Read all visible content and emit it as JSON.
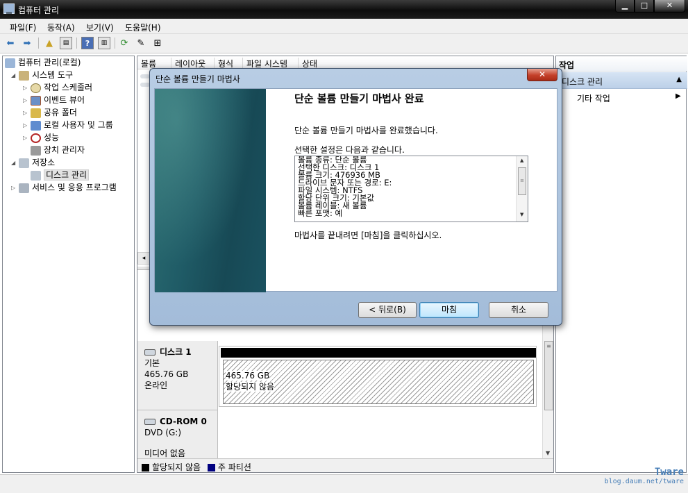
{
  "window": {
    "title": "컴퓨터 관리"
  },
  "menu": [
    "파일(F)",
    "동작(A)",
    "보기(V)",
    "도움말(H)"
  ],
  "tree": {
    "root": "컴퓨터 관리(로컬)",
    "system_tools": "시스템 도구",
    "task_scheduler": "작업 스케줄러",
    "event_viewer": "이벤트 뷰어",
    "shared_folders": "공유 폴더",
    "local_users": "로컬 사용자 및 그룹",
    "performance": "성능",
    "device_manager": "장치 관리자",
    "storage": "저장소",
    "disk_management": "디스크 관리",
    "services": "서비스 및 응용 프로그램"
  },
  "columns": [
    "볼륨",
    "레이아웃",
    "형식",
    "파일 시스템",
    "상태"
  ],
  "disks": [
    {
      "name": "디스크 1",
      "type": "기본",
      "size": "465.76 GB",
      "status": "온라인",
      "partition_size": "465.76 GB",
      "partition_status": "할당되지 않음"
    },
    {
      "name": "CD-ROM 0",
      "type": "DVD (G:)",
      "status": "미디어 없음"
    }
  ],
  "legend": {
    "unallocated": "할당되지 않음",
    "primary": "주 파티션",
    "unallocated_color": "#000000",
    "primary_color": "#000080"
  },
  "actions": {
    "header": "작업",
    "section": "디스크 관리",
    "item": "기타 작업"
  },
  "wizard": {
    "title": "단순 볼륨 만들기 마법사",
    "heading": "단순 볼륨 만들기 마법사 완료",
    "msg_done": "단순 볼륨 만들기 마법사를 완료했습니다.",
    "msg_settings": "선택한 설정은 다음과 같습니다.",
    "settings": [
      "볼륨 종류: 단순 볼륨",
      "선택한 디스크: 디스크 1",
      "볼륨 크기: 476936 MB",
      "드라이브 문자 또는 경로: E:",
      "파일 시스템: NTFS",
      "할당 단위 크기: 기본값",
      "볼륨 레이블: 새 볼륨",
      "빠른 포맷: 예"
    ],
    "msg_finish": "마법사를 끝내려면 [마침]을 클릭하십시오.",
    "back_label": "< 뒤로(B)",
    "finish_label": "마침",
    "cancel_label": "취소"
  },
  "watermark": {
    "brand": "Tware",
    "url": "blog.daum.net/tware"
  }
}
